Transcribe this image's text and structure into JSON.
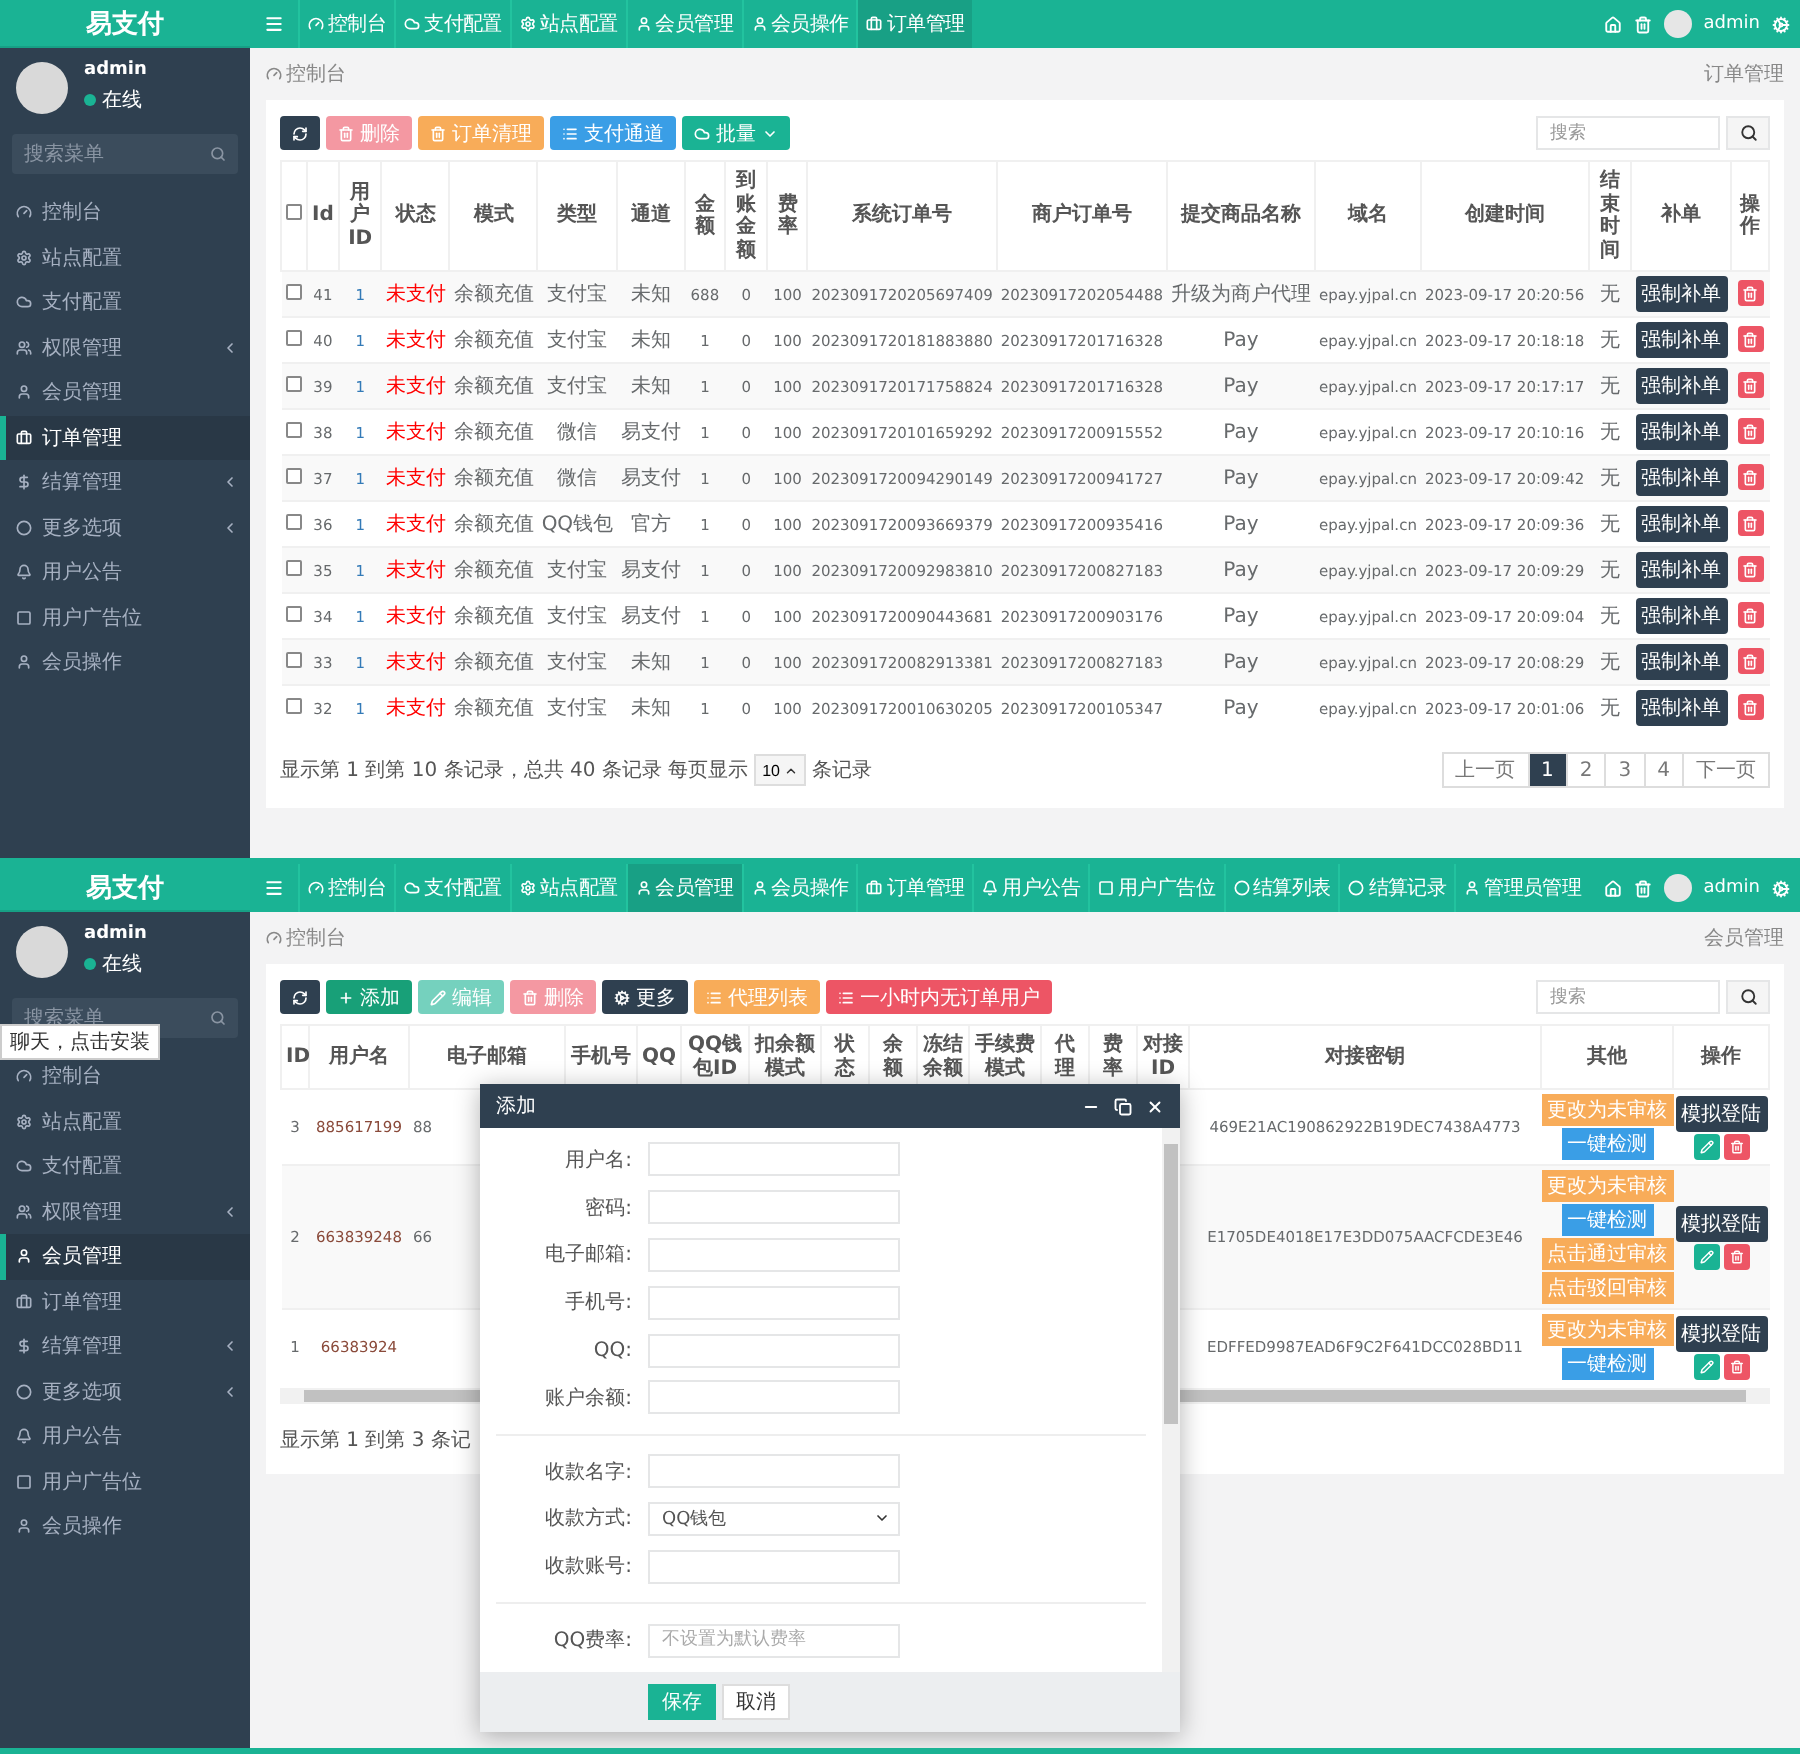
{
  "orders_screen": {
    "brand": "易支付",
    "nav": [
      {
        "label": "控制台",
        "selected": false
      },
      {
        "label": "支付配置",
        "selected": false
      },
      {
        "label": "站点配置",
        "selected": false
      },
      {
        "label": "会员管理",
        "selected": false
      },
      {
        "label": "会员操作",
        "selected": false
      },
      {
        "label": "订单管理",
        "selected": true
      }
    ],
    "top_user": "admin",
    "sidebar": {
      "user": {
        "name": "admin",
        "status": "在线"
      },
      "search_placeholder": "搜索菜单",
      "items": [
        {
          "label": "控制台",
          "has_submenu": false,
          "selected": false
        },
        {
          "label": "站点配置",
          "has_submenu": false,
          "selected": false
        },
        {
          "label": "支付配置",
          "has_submenu": false,
          "selected": false
        },
        {
          "label": "权限管理",
          "has_submenu": true,
          "selected": false
        },
        {
          "label": "会员管理",
          "has_submenu": false,
          "selected": false
        },
        {
          "label": "订单管理",
          "has_submenu": false,
          "selected": true
        },
        {
          "label": "结算管理",
          "has_submenu": true,
          "selected": false
        },
        {
          "label": "更多选项",
          "has_submenu": true,
          "selected": false
        },
        {
          "label": "用户公告",
          "has_submenu": false,
          "selected": false
        },
        {
          "label": "用户广告位",
          "has_submenu": false,
          "selected": false
        },
        {
          "label": "会员操作",
          "has_submenu": false,
          "selected": false
        }
      ]
    },
    "breadcrumb": "控制台",
    "page_title": "订单管理",
    "toolbar": [
      {
        "kind": "refresh",
        "disabled": false
      },
      {
        "kind": "delete",
        "label": "删除",
        "disabled": true
      },
      {
        "kind": "clean",
        "label": "订单清理",
        "disabled": false
      },
      {
        "kind": "channel",
        "label": "支付通道",
        "disabled": false
      },
      {
        "kind": "batch",
        "label": "批量",
        "disabled": false
      }
    ],
    "search_placeholder": "搜索",
    "header_checkbox": {
      "checked": false
    },
    "columns": [
      "Id",
      "用户ID",
      "状态",
      "模式",
      "类型",
      "通道",
      "金额",
      "到账金额",
      "费率",
      "系统订单号",
      "商户订单号",
      "提交商品名称",
      "域名",
      "创建时间",
      "结束时间",
      "补单",
      "操作"
    ],
    "rows": [
      {
        "checked": false,
        "id": "41",
        "user_id": "1",
        "status": "未支付",
        "mode": "余额充值",
        "type": "支付宝",
        "channel": "未知",
        "amount": "688",
        "received": "0",
        "rate": "100",
        "trade_no": "2023091720205697409",
        "out_trade_no": "20230917202054488",
        "product": "升级为商户代理",
        "domain": "epay.yjpal.cn",
        "created": "2023-09-17 20:20:56",
        "ended": "无",
        "fix_button": "强制补单"
      },
      {
        "checked": false,
        "id": "40",
        "user_id": "1",
        "status": "未支付",
        "mode": "余额充值",
        "type": "支付宝",
        "channel": "未知",
        "amount": "1",
        "received": "0",
        "rate": "100",
        "trade_no": "2023091720181883880",
        "out_trade_no": "20230917201716328",
        "product": "Pay",
        "domain": "epay.yjpal.cn",
        "created": "2023-09-17 20:18:18",
        "ended": "无",
        "fix_button": "强制补单"
      },
      {
        "checked": false,
        "id": "39",
        "user_id": "1",
        "status": "未支付",
        "mode": "余额充值",
        "type": "支付宝",
        "channel": "未知",
        "amount": "1",
        "received": "0",
        "rate": "100",
        "trade_no": "2023091720171758824",
        "out_trade_no": "20230917201716328",
        "product": "Pay",
        "domain": "epay.yjpal.cn",
        "created": "2023-09-17 20:17:17",
        "ended": "无",
        "fix_button": "强制补单"
      },
      {
        "checked": false,
        "id": "38",
        "user_id": "1",
        "status": "未支付",
        "mode": "余额充值",
        "type": "微信",
        "channel": "易支付",
        "amount": "1",
        "received": "0",
        "rate": "100",
        "trade_no": "2023091720101659292",
        "out_trade_no": "20230917200915552",
        "product": "Pay",
        "domain": "epay.yjpal.cn",
        "created": "2023-09-17 20:10:16",
        "ended": "无",
        "fix_button": "强制补单"
      },
      {
        "checked": false,
        "id": "37",
        "user_id": "1",
        "status": "未支付",
        "mode": "余额充值",
        "type": "微信",
        "channel": "易支付",
        "amount": "1",
        "received": "0",
        "rate": "100",
        "trade_no": "2023091720094290149",
        "out_trade_no": "20230917200941727",
        "product": "Pay",
        "domain": "epay.yjpal.cn",
        "created": "2023-09-17 20:09:42",
        "ended": "无",
        "fix_button": "强制补单"
      },
      {
        "checked": false,
        "id": "36",
        "user_id": "1",
        "status": "未支付",
        "mode": "余额充值",
        "type": "QQ钱包",
        "channel": "官方",
        "amount": "1",
        "received": "0",
        "rate": "100",
        "trade_no": "2023091720093669379",
        "out_trade_no": "20230917200935416",
        "product": "Pay",
        "domain": "epay.yjpal.cn",
        "created": "2023-09-17 20:09:36",
        "ended": "无",
        "fix_button": "强制补单"
      },
      {
        "checked": false,
        "id": "35",
        "user_id": "1",
        "status": "未支付",
        "mode": "余额充值",
        "type": "支付宝",
        "channel": "易支付",
        "amount": "1",
        "received": "0",
        "rate": "100",
        "trade_no": "2023091720092983810",
        "out_trade_no": "20230917200827183",
        "product": "Pay",
        "domain": "epay.yjpal.cn",
        "created": "2023-09-17 20:09:29",
        "ended": "无",
        "fix_button": "强制补单"
      },
      {
        "checked": false,
        "id": "34",
        "user_id": "1",
        "status": "未支付",
        "mode": "余额充值",
        "type": "支付宝",
        "channel": "易支付",
        "amount": "1",
        "received": "0",
        "rate": "100",
        "trade_no": "2023091720090443681",
        "out_trade_no": "20230917200903176",
        "product": "Pay",
        "domain": "epay.yjpal.cn",
        "created": "2023-09-17 20:09:04",
        "ended": "无",
        "fix_button": "强制补单"
      },
      {
        "checked": false,
        "id": "33",
        "user_id": "1",
        "status": "未支付",
        "mode": "余额充值",
        "type": "支付宝",
        "channel": "未知",
        "amount": "1",
        "received": "0",
        "rate": "100",
        "trade_no": "2023091720082913381",
        "out_trade_no": "20230917200827183",
        "product": "Pay",
        "domain": "epay.yjpal.cn",
        "created": "2023-09-17 20:08:29",
        "ended": "无",
        "fix_button": "强制补单"
      },
      {
        "checked": false,
        "id": "32",
        "user_id": "1",
        "status": "未支付",
        "mode": "余额充值",
        "type": "支付宝",
        "channel": "未知",
        "amount": "1",
        "received": "0",
        "rate": "100",
        "trade_no": "2023091720010630205",
        "out_trade_no": "20230917200105347",
        "product": "Pay",
        "domain": "epay.yjpal.cn",
        "created": "2023-09-17 20:01:06",
        "ended": "无",
        "fix_button": "强制补单"
      }
    ],
    "summary": "显示第 1 到第 10 条记录，总共 40 条记录 每页显示",
    "page_size": "10",
    "summary_suffix": "条记录",
    "pagination": [
      {
        "label": "上一页",
        "selected": false
      },
      {
        "label": "1",
        "selected": true
      },
      {
        "label": "2",
        "selected": false
      },
      {
        "label": "3",
        "selected": false
      },
      {
        "label": "4",
        "selected": false
      },
      {
        "label": "下一页",
        "selected": false
      }
    ]
  },
  "members_screen": {
    "brand": "易支付",
    "nav": [
      {
        "label": "控制台",
        "selected": false
      },
      {
        "label": "支付配置",
        "selected": false
      },
      {
        "label": "站点配置",
        "selected": false
      },
      {
        "label": "会员管理",
        "selected": true
      },
      {
        "label": "会员操作",
        "selected": false
      },
      {
        "label": "订单管理",
        "selected": false
      },
      {
        "label": "用户公告",
        "selected": false
      },
      {
        "label": "用户广告位",
        "selected": false
      },
      {
        "label": "结算列表",
        "selected": false
      },
      {
        "label": "结算记录",
        "selected": false
      },
      {
        "label": "管理员管理",
        "selected": false
      }
    ],
    "top_user": "admin",
    "sidebar": {
      "user": {
        "name": "admin",
        "status": "在线"
      },
      "search_placeholder": "搜索菜单",
      "items": [
        {
          "label": "控制台",
          "has_submenu": false,
          "selected": false
        },
        {
          "label": "站点配置",
          "has_submenu": false,
          "selected": false
        },
        {
          "label": "支付配置",
          "has_submenu": false,
          "selected": false
        },
        {
          "label": "权限管理",
          "has_submenu": true,
          "selected": false
        },
        {
          "label": "会员管理",
          "has_submenu": false,
          "selected": true
        },
        {
          "label": "订单管理",
          "has_submenu": false,
          "selected": false
        },
        {
          "label": "结算管理",
          "has_submenu": true,
          "selected": false
        },
        {
          "label": "更多选项",
          "has_submenu": true,
          "selected": false
        },
        {
          "label": "用户公告",
          "has_submenu": false,
          "selected": false
        },
        {
          "label": "用户广告位",
          "has_submenu": false,
          "selected": false
        },
        {
          "label": "会员操作",
          "has_submenu": false,
          "selected": false
        }
      ]
    },
    "tooltip": "聊天，点击安装",
    "breadcrumb": "控制台",
    "page_title": "会员管理",
    "toolbar": [
      {
        "kind": "refresh",
        "disabled": false
      },
      {
        "kind": "add",
        "label": "添加",
        "disabled": false
      },
      {
        "kind": "edit",
        "label": "编辑",
        "disabled": true
      },
      {
        "kind": "delete",
        "label": "删除",
        "disabled": true
      },
      {
        "kind": "more",
        "label": "更多",
        "disabled": false
      },
      {
        "kind": "agents",
        "label": "代理列表",
        "disabled": false
      },
      {
        "kind": "inactive",
        "label": "一小时内无订单用户",
        "disabled": false
      }
    ],
    "search_placeholder": "搜索",
    "columns": [
      "ID",
      "用户名",
      "电子邮箱",
      "手机号",
      "QQ",
      "QQ钱包ID",
      "扣余额模式",
      "状态",
      "余额",
      "冻结余额",
      "手续费模式",
      "代理",
      "费率",
      "对接ID",
      "对接密钥",
      "其他",
      "操作"
    ],
    "rows": [
      {
        "id": "3",
        "username": "885617199",
        "email": "88",
        "key": "469E21AC190862922B19DEC7438A4773",
        "other": [
          {
            "label": "更改为未审核",
            "kind": "warning"
          },
          {
            "label": "一键检测",
            "kind": "info"
          }
        ],
        "login_button": "模拟登陆"
      },
      {
        "id": "2",
        "username": "663839248",
        "email": "66",
        "key": "E1705DE4018E17E3DD075AACFCDE3E46",
        "other": [
          {
            "label": "更改为未审核",
            "kind": "warning"
          },
          {
            "label": "一键检测",
            "kind": "info"
          },
          {
            "label": "点击通过审核",
            "kind": "warning"
          },
          {
            "label": "点击驳回审核",
            "kind": "warning"
          }
        ],
        "login_button": "模拟登陆"
      },
      {
        "id": "1",
        "username": "66383924",
        "email": "",
        "key": "EDFFED9987EAD6F9C2F641DCC028BD11",
        "other": [
          {
            "label": "更改为未审核",
            "kind": "warning"
          },
          {
            "label": "一键检测",
            "kind": "info"
          }
        ],
        "login_button": "模拟登陆"
      }
    ],
    "summary": "显示第 1 到第 3 条记",
    "dialog": {
      "title": "添加",
      "fields": [
        {
          "kind": "text",
          "label": "用户名:"
        },
        {
          "kind": "text",
          "label": "密码:"
        },
        {
          "kind": "text",
          "label": "电子邮箱:"
        },
        {
          "kind": "text",
          "label": "手机号:"
        },
        {
          "kind": "text",
          "label": "QQ:"
        },
        {
          "kind": "text",
          "label": "账户余额:"
        },
        {
          "kind": "divider"
        },
        {
          "kind": "text",
          "label": "收款名字:"
        },
        {
          "kind": "select",
          "label": "收款方式:",
          "value": "QQ钱包"
        },
        {
          "kind": "text",
          "label": "收款账号:"
        },
        {
          "kind": "divider"
        },
        {
          "kind": "text",
          "label": "QQ费率:",
          "placeholder": "不设置为默认费率"
        }
      ],
      "buttons": [
        {
          "kind": "primary",
          "label": "保存"
        },
        {
          "kind": "default",
          "label": "取消"
        }
      ]
    }
  }
}
